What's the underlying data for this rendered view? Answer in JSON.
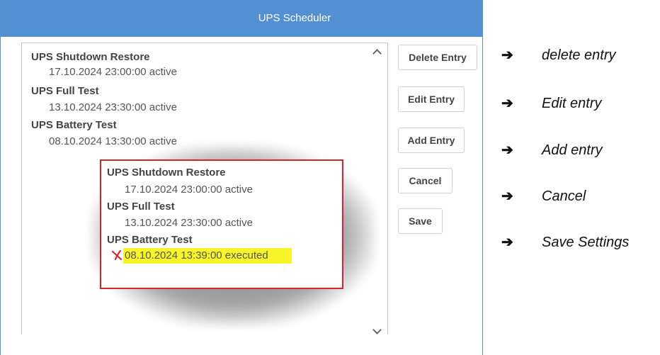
{
  "dialog": {
    "title": "UPS Scheduler"
  },
  "schedule": [
    {
      "name": "UPS Shutdown Restore",
      "detail": "17.10.2024 23:00:00 active"
    },
    {
      "name": "UPS Full Test",
      "detail": "13.10.2024 23:30:00 active"
    },
    {
      "name": "UPS Battery Test",
      "detail": "08.10.2024 13:30:00 active"
    }
  ],
  "zoom": [
    {
      "name": "UPS Shutdown Restore",
      "detail": "17.10.2024 23:00:00 active"
    },
    {
      "name": "UPS Full Test",
      "detail": "13.10.2024 23:30:00 active"
    },
    {
      "name": "UPS Battery Test",
      "detail": "08.10.2024 13:39:00 executed"
    }
  ],
  "buttons": {
    "delete": "Delete Entry",
    "edit": "Edit Entry",
    "add": "Add Entry",
    "cancel": "Cancel",
    "save": "Save"
  },
  "notes": {
    "arrow": "➔",
    "delete": "delete entry",
    "edit": "Edit entry",
    "add": "Add entry",
    "cancel": "Cancel",
    "save": "Save Settings"
  },
  "colors": {
    "titlebar": "#5290d1",
    "inset_border": "#d9232c",
    "highlight": "#f7f52a",
    "mark": "#e0202a"
  },
  "icons": {
    "scroll_up": "chevron-up-icon",
    "scroll_down": "chevron-down-icon",
    "mark": "red-x-icon"
  }
}
